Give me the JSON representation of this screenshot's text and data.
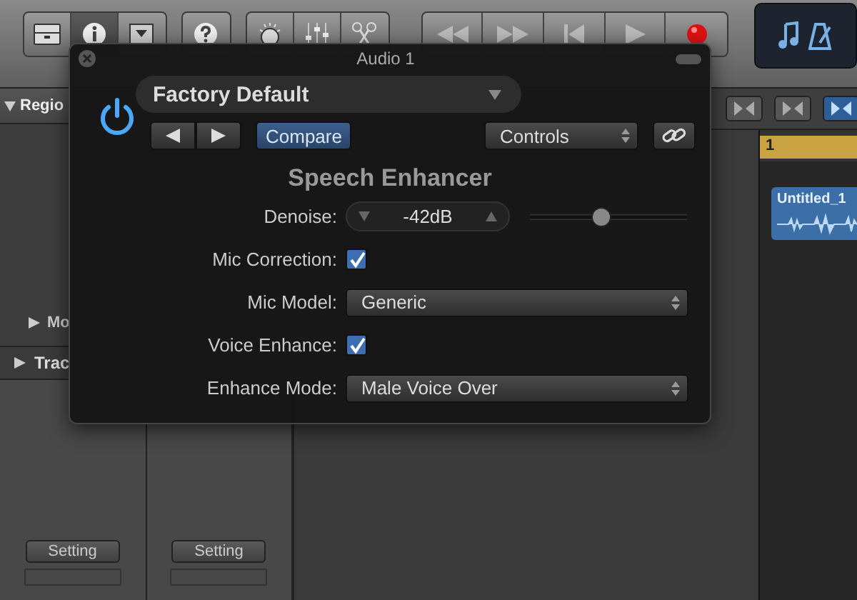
{
  "toolbar": {
    "view_buttons": [
      {
        "selected": false
      },
      {
        "selected": true
      },
      {
        "selected": false
      }
    ]
  },
  "inspector": {
    "region_header": "Regio",
    "more": "Mo",
    "track_header": "Trac",
    "strips": [
      {
        "setting": "Setting"
      },
      {
        "setting": "Setting"
      }
    ]
  },
  "tracks": {
    "tools": [
      {
        "selected": false
      },
      {
        "selected": false
      },
      {
        "selected": true
      }
    ],
    "ruler": "1",
    "region": "Untitled_1"
  },
  "plugin": {
    "title": "Audio 1",
    "power": true,
    "preset": "Factory Default",
    "compare": "Compare",
    "view_menu": "Controls",
    "name": "Speech Enhancer",
    "rows": [
      {
        "label": "Denoise:",
        "kind": "stepper",
        "value": "-42dB",
        "level": 0.45
      },
      {
        "label": "Mic Correction:",
        "kind": "checkbox",
        "checked": true
      },
      {
        "label": "Mic Model:",
        "kind": "select",
        "value": "Generic"
      },
      {
        "label": "Voice Enhance:",
        "kind": "checkbox",
        "checked": true
      },
      {
        "label": "Enhance Mode:",
        "kind": "select",
        "value": "Male Voice Over"
      }
    ]
  }
}
